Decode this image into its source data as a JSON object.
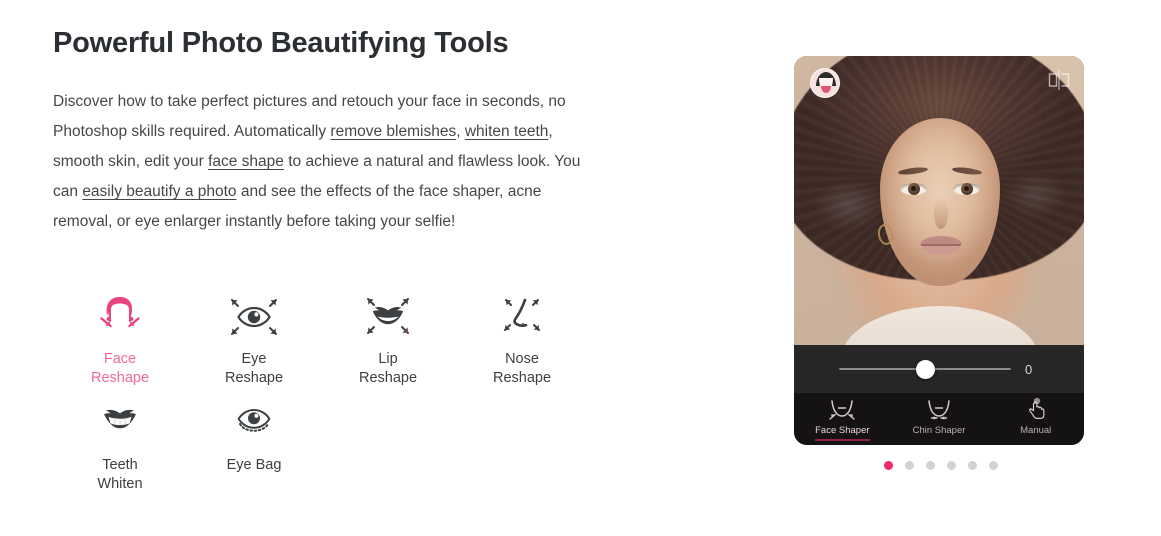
{
  "heading": "Powerful Photo Beautifying Tools",
  "intro": {
    "part1": "Discover how to take perfect pictures and retouch your face in seconds, no Photoshop skills required. Automatically ",
    "link1": "remove blemishes",
    "part2": ", ",
    "link2": "whiten teeth",
    "part3": ", smooth skin, edit your ",
    "link3": "face shape",
    "part4": " to achieve a natural and flawless look. You can ",
    "link4": "easily beautify a photo",
    "part5": " and see the effects of the face shaper, acne removal, or eye enlarger instantly before taking your selfie!"
  },
  "colors": {
    "accent_pink": "#ef2a6d",
    "active_label_pink": "#ee6a94",
    "icon_dark": "#3c4043",
    "text_body": "#44474a",
    "heading": "#2b2f33"
  },
  "features": [
    {
      "label_line1": "Face",
      "label_line2": "Reshape",
      "icon": "face-reshape-icon",
      "active": true
    },
    {
      "label_line1": "Eye",
      "label_line2": "Reshape",
      "icon": "eye-reshape-icon",
      "active": false
    },
    {
      "label_line1": "Lip",
      "label_line2": "Reshape",
      "icon": "lip-reshape-icon",
      "active": false
    },
    {
      "label_line1": "Nose",
      "label_line2": "Reshape",
      "icon": "nose-reshape-icon",
      "active": false
    },
    {
      "label_line1": "Teeth",
      "label_line2": "Whiten",
      "icon": "teeth-whiten-icon",
      "active": false
    },
    {
      "label_line1": "Eye Bag",
      "label_line2": "",
      "icon": "eye-bag-icon",
      "active": false
    }
  ],
  "phone": {
    "avatar_icon": "face-avatar-icon",
    "compare_icon": "compare-mirror-icon",
    "slider": {
      "value": "0",
      "position_percent": 50
    },
    "tabs": [
      {
        "label": "Face Shaper",
        "icon": "face-shaper-icon",
        "active": true
      },
      {
        "label": "Chin Shaper",
        "icon": "chin-shaper-icon",
        "active": false
      },
      {
        "label": "Manual",
        "icon": "hand-tap-icon",
        "active": false
      }
    ]
  },
  "carousel": {
    "total": 6,
    "active_index": 0
  }
}
